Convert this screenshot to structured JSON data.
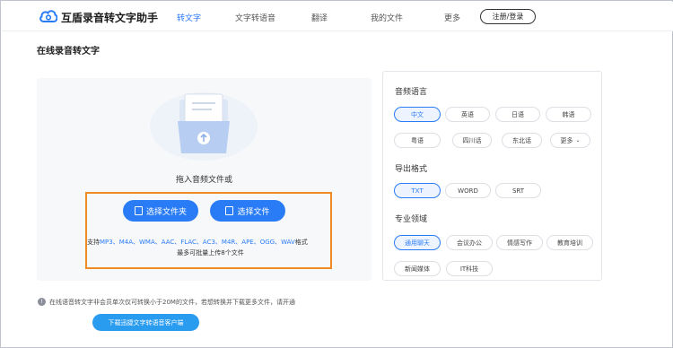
{
  "header": {
    "app_title": "互盾录音转文字助手",
    "nav": [
      "转文字",
      "文字转语音",
      "翻译",
      "我的文件",
      "更多"
    ],
    "login_label": "注册/登录"
  },
  "page_title": "在线录音转文字",
  "upload": {
    "drop_text": "拖入音频文件或",
    "select_folder_label": "选择文件夹",
    "select_file_label": "选择文件",
    "formats_prefix": "支持",
    "formats_list": "MP3、M4A、WMA、AAC、FLAC、AC3、M4R、APE、OGG、WAV",
    "formats_suffix": "格式",
    "limit_text": "最多可批量上传8个文件"
  },
  "options": {
    "language_label": "音频语言",
    "languages": [
      "中文",
      "英语",
      "日语",
      "韩语",
      "粤语",
      "四川话",
      "东北话",
      "更多"
    ],
    "selected_language": "中文",
    "format_label": "导出格式",
    "formats": [
      "TXT",
      "WORD",
      "SRT"
    ],
    "selected_format": "TXT",
    "domain_label": "专业领域",
    "domains": [
      "通用聊天",
      "会议办公",
      "情感写作",
      "教育培训",
      "新闻媒体",
      "IT科技"
    ],
    "selected_domain": "通用聊天"
  },
  "footer": {
    "note": "在线语音转文字非会员单次仅可转换小于20M的文件，若想转换并下载更多文件，请开通",
    "download_label": "下载迅捷文字转语音客户端"
  },
  "colors": {
    "accent": "#2a7cf6",
    "highlight": "#f08a24",
    "download": "#2a9cf0"
  }
}
